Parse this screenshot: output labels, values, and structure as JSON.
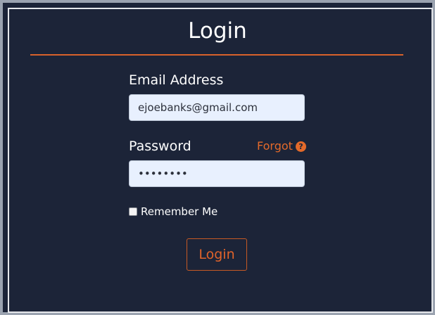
{
  "title": "Login",
  "email": {
    "label": "Email Address",
    "value": "ejoebanks@gmail.com"
  },
  "password": {
    "label": "Password",
    "masked_value": "••••••••",
    "forgot_label": "Forgot",
    "help_glyph": "?"
  },
  "remember": {
    "label": "Remember Me",
    "checked": false
  },
  "submit_label": "Login",
  "colors": {
    "background": "#1c2438",
    "accent": "#e46a2a",
    "field_background": "#e8f0fe"
  },
  "icons": {
    "help": "question-circle-icon"
  }
}
